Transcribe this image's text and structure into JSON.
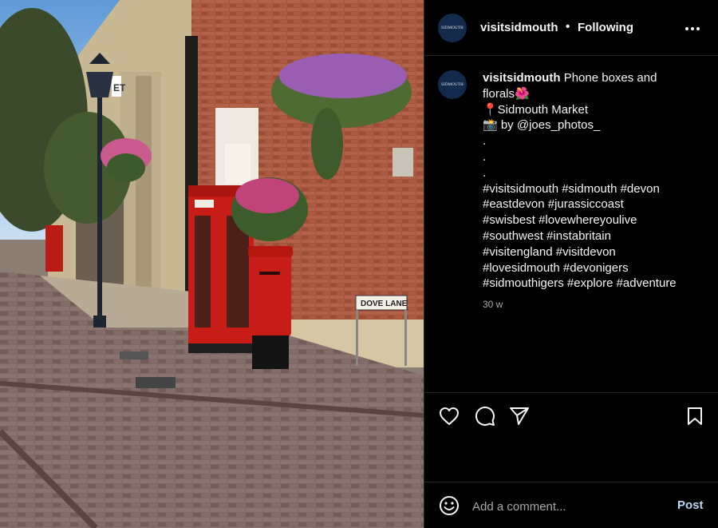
{
  "post": {
    "username": "visitsidmouth",
    "separator": "•",
    "follow_status": "Following",
    "avatar_text": "SIDMOUTH",
    "caption": {
      "username": "visitsidmouth",
      "lines": [
        "Phone boxes and",
        "florals🌺",
        "📍Sidmouth Market",
        "📸 by @joes_photos_",
        ".",
        ".",
        ".",
        "#visitsidmouth #sidmouth #devon",
        "#eastdevon #jurassiccoast",
        "#swisbest #lovewhereyoulive",
        "#southwest #instabritain",
        "#visitengland #visitdevon",
        "#lovesidmouth #devonigers",
        "#sidmouthigers #explore #adventure"
      ],
      "timestamp": "30 w"
    },
    "photo": {
      "street_sign": "DOVE LANE",
      "building_sign": "ET"
    }
  },
  "actions": [
    "heart-icon",
    "comment-icon",
    "share-icon",
    "bookmark-icon"
  ],
  "comment": {
    "placeholder": "Add a comment...",
    "post_label": "Post"
  },
  "colors": {
    "background": "#000000",
    "divider": "#262626",
    "post_button": "#b9d7f7",
    "phone_box_red": "#c81d16"
  }
}
